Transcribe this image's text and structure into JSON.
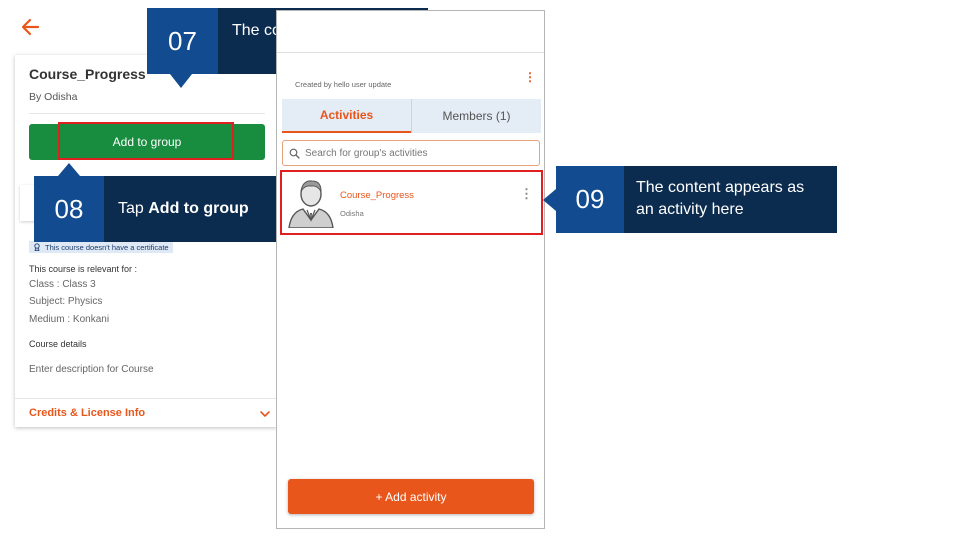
{
  "left_screen": {
    "course_title": "Course_Progress",
    "course_by": "By Odisha",
    "add_to_group_label": "Add to group",
    "certificate_note": "This course doesn't have a certificate",
    "relevant_heading": "This course is relevant for :",
    "meta": [
      "Class : Class 3",
      "Subject: Physics",
      "Medium : Konkani"
    ],
    "details_heading": "Course details",
    "details_text": "Enter description for Course",
    "credits_label": "Credits & License Info"
  },
  "right_screen": {
    "created_by": "Created by hello user update",
    "tabs": [
      {
        "label": "Activities"
      },
      {
        "label": "Members (1)"
      }
    ],
    "search_placeholder": "Search for group's activities",
    "activity": {
      "title": "Course_Progress",
      "subtitle": "Odisha"
    },
    "add_activity_label": "+ Add activity"
  },
  "callouts": {
    "c07": {
      "number": "07",
      "text": "The content page opens"
    },
    "c08": {
      "number": "08",
      "text_prefix": "Tap ",
      "text_bold": "Add to group"
    },
    "c09": {
      "number": "09",
      "text": "The content appears as an activity here"
    }
  },
  "colors": {
    "accent_orange": "#e8561c",
    "green_button": "#188c3f",
    "callout_number_bg": "#124b8f",
    "callout_text_bg": "#0b2b4f",
    "highlight_red": "#e02020"
  },
  "icons": {
    "back": "arrow-left-icon",
    "search": "search-icon",
    "kebab": "kebab-menu-icon",
    "chevron": "chevron-down-icon",
    "certificate": "certificate-icon",
    "avatar": "user-avatar-icon"
  }
}
